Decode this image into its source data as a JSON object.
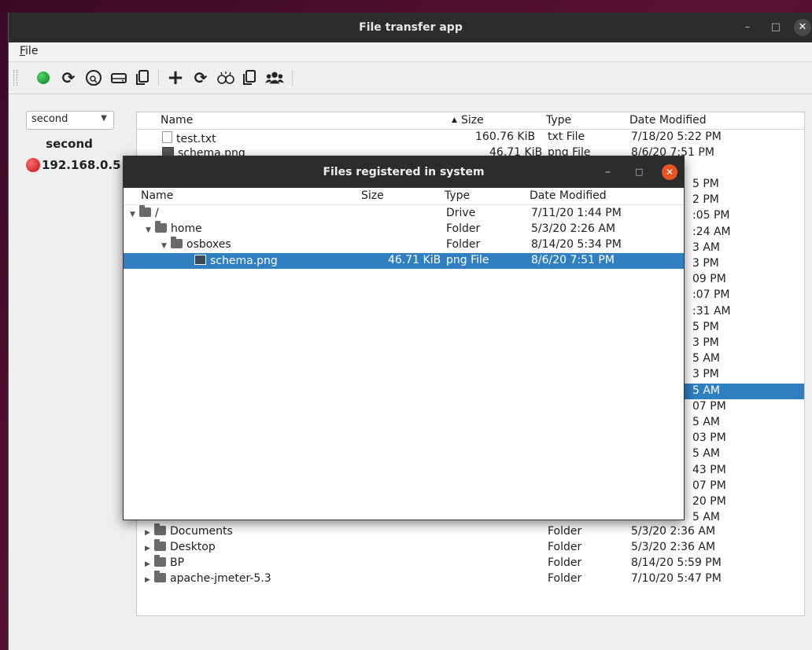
{
  "window": {
    "title": "File transfer app",
    "min": "–",
    "max": "□",
    "close": "✕"
  },
  "menu": {
    "file_first": "F",
    "file_rest": "ile"
  },
  "toolbar": {
    "icons": [
      "status-connected-icon",
      "refresh-icon",
      "search-file-icon",
      "drive-icon",
      "copy-icon",
      "add-icon",
      "refresh-icon",
      "find-peers-icon",
      "copy-icon",
      "group-icon"
    ]
  },
  "left": {
    "combo_value": "second",
    "hostname": "second",
    "ip": "192.168.0.5"
  },
  "tree": {
    "headers": {
      "name": "Name",
      "size": "Size",
      "type": "Type",
      "date": "Date Modified",
      "sort_indicator": "▲"
    },
    "top_rows": [
      {
        "name": "test.txt",
        "size": "160.76 KiB",
        "type": "txt File",
        "date": "7/18/20 5:22 PM",
        "icon": "text-file-icon"
      },
      {
        "name": "schema.png",
        "size": "46.71 KiB",
        "type": "png File",
        "date": "8/6/20 7:51 PM",
        "icon": "image-file-icon"
      }
    ],
    "partial_dates": [
      "5 PM",
      "2 PM",
      ":05 PM",
      ":24 AM",
      "3 AM",
      "3 PM",
      "09 PM",
      ":07 PM",
      ":31 AM",
      "5 PM",
      "3 PM",
      "5 AM",
      "3 PM",
      "5 AM",
      "07 PM",
      "5 AM",
      "03 PM",
      "5 AM",
      "43 PM",
      "07 PM",
      "20 PM",
      "5 AM"
    ],
    "bottom_rows": [
      {
        "name": "Documents",
        "type": "Folder",
        "date": "5/3/20 2:36 AM"
      },
      {
        "name": "Desktop",
        "type": "Folder",
        "date": "5/3/20 2:36 AM"
      },
      {
        "name": "BP",
        "type": "Folder",
        "date": "8/14/20 5:59 PM"
      },
      {
        "name": "apache-jmeter-5.3",
        "type": "Folder",
        "date": "7/10/20 5:47 PM"
      }
    ]
  },
  "dialog": {
    "title": "Files registered in system",
    "headers": {
      "name": "Name",
      "size": "Size",
      "type": "Type",
      "date": "Date Modified"
    },
    "rows": [
      {
        "name": "/",
        "size": "",
        "type": "Drive",
        "date": "7/11/20 1:44 PM",
        "depth": 0
      },
      {
        "name": "home",
        "size": "",
        "type": "Folder",
        "date": "5/3/20 2:26 AM",
        "depth": 1
      },
      {
        "name": "osboxes",
        "size": "",
        "type": "Folder",
        "date": "8/14/20 5:34 PM",
        "depth": 2
      },
      {
        "name": "schema.png",
        "size": "46.71 KiB",
        "type": "png File",
        "date": "8/6/20 7:51 PM",
        "depth": 3,
        "selected": true
      }
    ]
  }
}
